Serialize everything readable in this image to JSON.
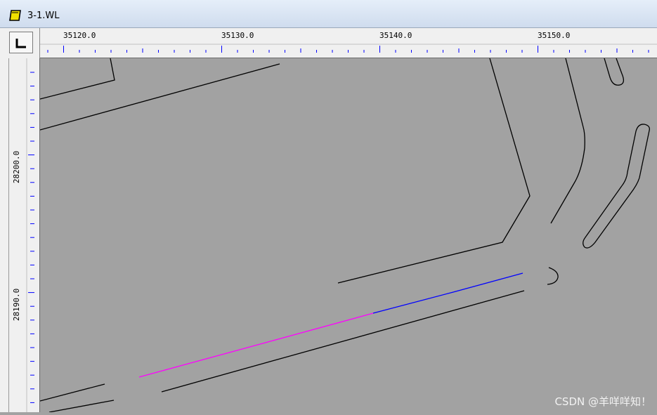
{
  "window": {
    "title": "3-1.WL"
  },
  "icons": {
    "app": "document-icon",
    "origin": "origin-corner-icon"
  },
  "ruler_x": {
    "labels": [
      "35120.0",
      "35130.0",
      "35140.0",
      "35150.0"
    ]
  },
  "ruler_y": {
    "labels": [
      "28200.0",
      "28190.0"
    ]
  },
  "colors": {
    "canvas": "#a2a2a2",
    "tick": "#0000ff",
    "drawing": "#000000",
    "selected_a": "#ff00ff",
    "selected_b": "#0000ff"
  },
  "watermark": "CSDN @羊咩咩知！"
}
